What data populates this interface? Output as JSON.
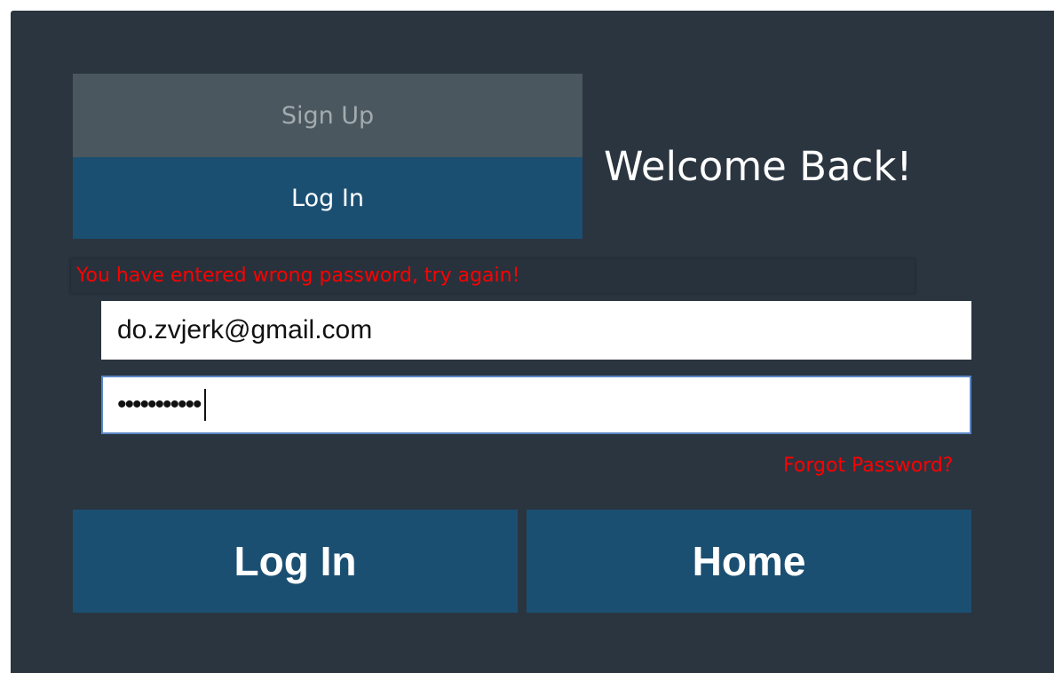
{
  "tabs": {
    "signup_label": "Sign Up",
    "login_label": "Log In"
  },
  "welcome_title": "Welcome Back!",
  "error_message": "You have entered wrong password, try again!",
  "form": {
    "email_value": "do.zvjerk@gmail.com",
    "password_masked": "•••••••••••",
    "forgot_password_label": "Forgot Password?"
  },
  "buttons": {
    "login_label": "Log In",
    "home_label": "Home"
  },
  "colors": {
    "panel_background": "#2a3540",
    "active_tab_and_buttons": "#1b4f72",
    "inactive_tab": "#4a575e",
    "error_text": "#ff0000"
  }
}
